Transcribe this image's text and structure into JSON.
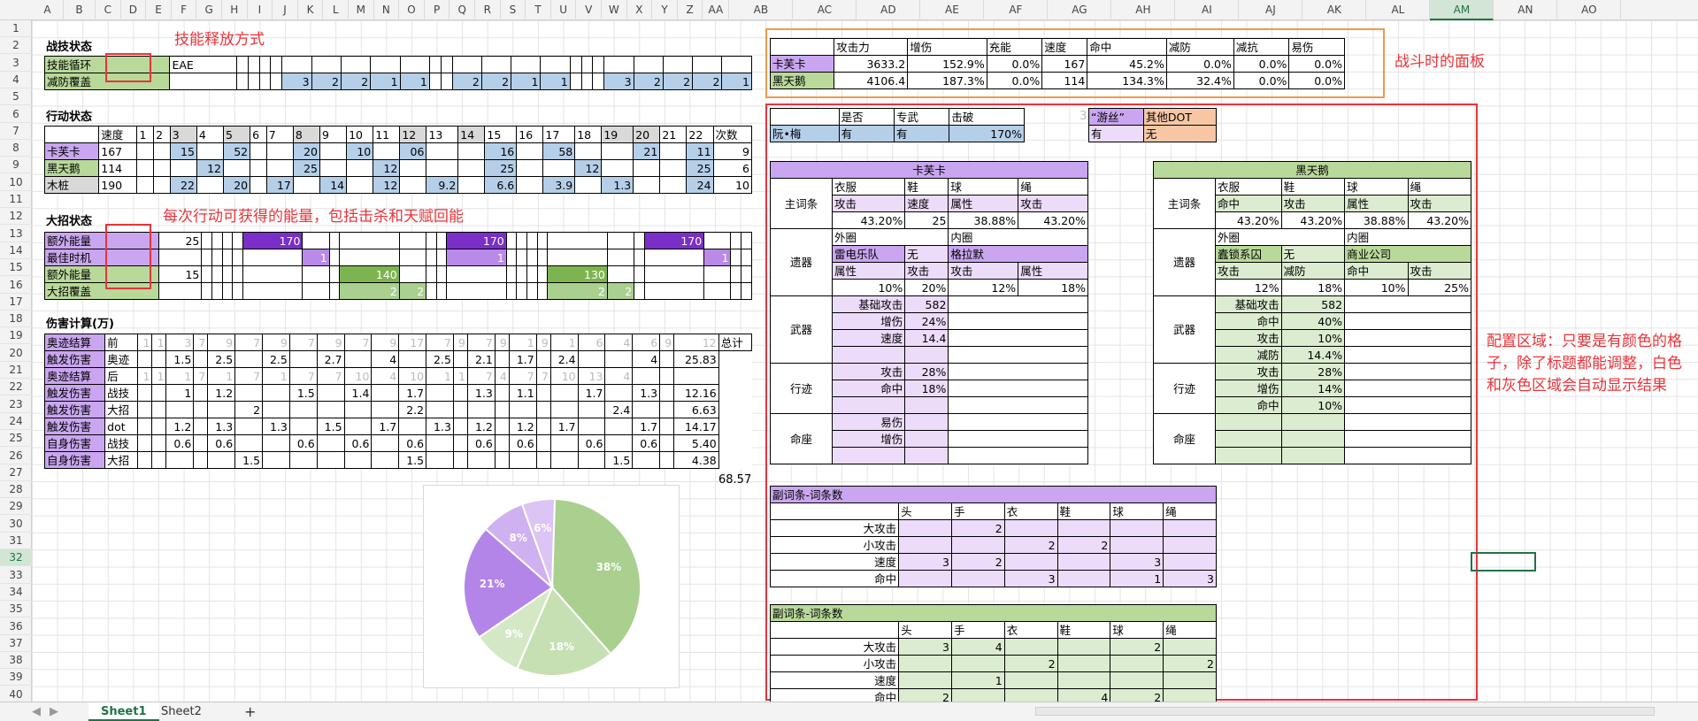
{
  "columns": [
    "A",
    "B",
    "C",
    "D",
    "E",
    "F",
    "G",
    "H",
    "I",
    "J",
    "K",
    "L",
    "M",
    "N",
    "O",
    "P",
    "Q",
    "R",
    "S",
    "T",
    "U",
    "V",
    "W",
    "X",
    "Y",
    "Z",
    "AA",
    "AB",
    "AC",
    "AD",
    "AE",
    "AF",
    "AG",
    "AH",
    "AI",
    "AJ",
    "AK",
    "AL",
    "AM",
    "AN",
    "AO"
  ],
  "rows": [
    "1",
    "2",
    "3",
    "4",
    "5",
    "6",
    "7",
    "8",
    "9",
    "10",
    "11",
    "12",
    "13",
    "14",
    "15",
    "16",
    "17",
    "18",
    "19",
    "20",
    "21",
    "22",
    "23",
    "24",
    "25",
    "26",
    "27",
    "28",
    "29",
    "30",
    "31",
    "32",
    "33",
    "34",
    "35",
    "36",
    "37",
    "38",
    "39",
    "40"
  ],
  "sheet": {
    "tabs": [
      "Sheet1",
      "Sheet2"
    ],
    "add_sheet": "+",
    "selected_cell": "AM32"
  },
  "annotations": {
    "skill_mode": "技能释放方式",
    "energy_note": "每次行动可获得的能量，包括击杀和天赋回能",
    "battle_panel": "战斗时的面板",
    "config_area": "配置区域：只要是有颜色的格子，除了标题都能调整，白色和灰色区域会自动显示结果"
  },
  "battle_skill": {
    "title": "战技状态",
    "rows": [
      {
        "label": "技能循环",
        "value": "EAE"
      },
      {
        "label": "减防覆盖",
        "cells": [
          "",
          "",
          "",
          "",
          "3",
          "2",
          "2",
          "1",
          "1",
          "",
          "",
          "2",
          "2",
          "1",
          "1",
          "",
          "",
          "",
          "3",
          "2",
          "2",
          "2",
          "1"
        ]
      }
    ]
  },
  "action": {
    "title": "行动状态",
    "header": [
      "速度",
      "1",
      "2",
      "3",
      "4",
      "5",
      "6",
      "7",
      "8",
      "9",
      "10",
      "11",
      "12",
      "13",
      "14",
      "15",
      "16",
      "17",
      "18",
      "19",
      "20",
      "21",
      "22",
      "次数"
    ],
    "rows": [
      {
        "label": "卡芙卡",
        "speed": "167",
        "cells": [
          "",
          "",
          "15",
          "",
          "52",
          "",
          "",
          "20",
          "",
          "10",
          "",
          "06",
          "",
          "",
          "16",
          "",
          "58",
          "",
          "",
          "21",
          "",
          "11"
        ],
        "count": "9"
      },
      {
        "label": "黑天鹅",
        "speed": "114",
        "cells": [
          "",
          "",
          "",
          "12",
          "",
          "",
          "",
          "25",
          "",
          "",
          "12",
          "",
          "",
          "",
          "25",
          "",
          "",
          "12",
          "",
          "",
          "",
          "25"
        ],
        "count": "6"
      },
      {
        "label": "木桩",
        "speed": "190",
        "cells": [
          "",
          "",
          "22",
          "",
          "20",
          "",
          "17",
          "",
          "14",
          "",
          "12",
          "",
          "9.2",
          "",
          "6.6",
          "",
          "3.9",
          "",
          "1.3",
          "",
          "",
          "24"
        ],
        "count": "10"
      }
    ]
  },
  "ultimate": {
    "title": "大招状态",
    "rows": [
      {
        "label": "额外能量",
        "value": "25",
        "cells": [
          "",
          "",
          "",
          "",
          "170",
          "",
          "",
          "",
          "",
          "",
          "",
          "170",
          "",
          "",
          "",
          "",
          "",
          "",
          "",
          "170",
          "",
          ""
        ]
      },
      {
        "label": "最佳时机",
        "value": "",
        "cells": [
          "",
          "",
          "",
          "",
          "",
          "1",
          "",
          "",
          "",
          "",
          "",
          "1",
          "",
          "",
          "",
          "",
          "",
          "",
          "",
          "",
          "1",
          ""
        ]
      },
      {
        "label": "额外能量",
        "value": "15",
        "cells": [
          "",
          "",
          "",
          "",
          "",
          "",
          "",
          "140",
          "",
          "",
          "",
          "",
          "",
          "",
          "",
          "",
          "130",
          "",
          "",
          "",
          "",
          ""
        ]
      },
      {
        "label": "大招覆盖",
        "value": "",
        "cells": [
          "",
          "",
          "",
          "",
          "",
          "",
          "",
          "2",
          "2",
          "",
          "",
          "",
          "",
          "",
          "",
          "",
          "2",
          "2",
          "",
          "",
          "",
          ""
        ]
      }
    ]
  },
  "damage": {
    "title": "伤害计算(万)",
    "total_label": "总计",
    "rows": [
      {
        "a": "奥迹结算",
        "b": "前",
        "cells": [
          "1",
          "1",
          "3",
          "7",
          "9",
          "7",
          "9",
          "7",
          "9",
          "7",
          "9",
          "17",
          "7",
          "9",
          "7",
          "9",
          "1",
          "9",
          "1",
          "6",
          "4",
          "6",
          "9",
          "12"
        ],
        "total": ""
      },
      {
        "a": "触发伤害",
        "b": "奥迹",
        "cells": [
          "",
          "",
          "1.5",
          "",
          "2.5",
          "",
          "2.5",
          "",
          "2.7",
          "",
          "4",
          "",
          "2.5",
          "",
          "2.1",
          "",
          "1.7",
          "",
          "2.4",
          "",
          "",
          "4"
        ],
        "total": "25.83"
      },
      {
        "a": "奥迹结算",
        "b": "后",
        "cells": [
          "1",
          "1",
          "1",
          "7",
          "1",
          "7",
          "1",
          "7",
          "7",
          "10",
          "4",
          "10",
          "1",
          "1",
          "7",
          "4",
          "7",
          "7",
          "10",
          "13",
          "4"
        ],
        "total": ""
      },
      {
        "a": "触发伤害",
        "b": "战技",
        "cells": [
          "",
          "",
          "1",
          "",
          "1.2",
          "",
          "",
          "1.5",
          "",
          "1.4",
          "",
          "1.7",
          "",
          "",
          "1.3",
          "",
          "1.1",
          "",
          "",
          "1.7",
          "",
          "1.3"
        ],
        "total": "12.16"
      },
      {
        "a": "触发伤害",
        "b": "大招",
        "cells": [
          "",
          "",
          "",
          "",
          "",
          "2",
          "",
          "",
          "",
          "",
          "",
          "2.2",
          "",
          "",
          "",
          "",
          "",
          "",
          "",
          "",
          "2.4",
          ""
        ],
        "total": "6.63"
      },
      {
        "a": "触发伤害",
        "b": "dot",
        "cells": [
          "",
          "",
          "1.2",
          "",
          "1.3",
          "",
          "1.3",
          "",
          "1.5",
          "",
          "1.7",
          "",
          "1.3",
          "",
          "1.2",
          "",
          "1.2",
          "",
          "1.7",
          "",
          "",
          "1.7"
        ],
        "total": "14.17"
      },
      {
        "a": "自身伤害",
        "b": "战技",
        "cells": [
          "",
          "",
          "0.6",
          "",
          "0.6",
          "",
          "",
          "0.6",
          "",
          "0.6",
          "",
          "0.6",
          "",
          "",
          "0.6",
          "",
          "0.6",
          "",
          "",
          "0.6",
          "",
          "0.6"
        ],
        "total": "5.40"
      },
      {
        "a": "自身伤害",
        "b": "大招",
        "cells": [
          "",
          "",
          "",
          "",
          "",
          "1.5",
          "",
          "",
          "",
          "",
          "",
          "1.5",
          "",
          "",
          "",
          "",
          "",
          "",
          "",
          "",
          "1.5",
          ""
        ],
        "total": "4.38"
      }
    ],
    "grand_total": "68.57"
  },
  "panel": {
    "headers": [
      "攻击力",
      "增伤",
      "充能",
      "速度",
      "命中",
      "减防",
      "减抗",
      "易伤"
    ],
    "rows": [
      {
        "name": "卡芙卡",
        "values": [
          "3633.2",
          "152.9%",
          "0.0%",
          "167",
          "45.2%",
          "0.0%",
          "0.0%",
          "0.0%"
        ]
      },
      {
        "name": "黑天鹅",
        "values": [
          "4106.4",
          "187.3%",
          "0.0%",
          "114",
          "134.3%",
          "32.4%",
          "0.0%",
          "0.0%"
        ]
      }
    ]
  },
  "ruanmei": {
    "headers": [
      "是否",
      "专武",
      "击破"
    ],
    "name": "阮•梅",
    "values": [
      "有",
      "有",
      "170%"
    ]
  },
  "extra": {
    "headers": [
      "“游丝”",
      "其他DOT"
    ],
    "values": [
      "有",
      "无"
    ],
    "prefix": "3"
  },
  "kafka": {
    "title": "卡芙卡",
    "main_label": "主词条",
    "main_slots": [
      "衣服",
      "鞋",
      "球",
      "绳"
    ],
    "main_stats": [
      "攻击",
      "速度",
      "属性",
      "攻击"
    ],
    "main_values": [
      "43.20%",
      "25",
      "38.88%",
      "43.20%"
    ],
    "relic_label": "遗器",
    "outer_label": "外圈",
    "inner_label": "内圈",
    "outer_set": "雷电乐队",
    "outer_set2": "无",
    "inner_set": "格拉默",
    "relic_stats": [
      "属性",
      "攻击",
      "攻击",
      "属性"
    ],
    "relic_values": [
      "10%",
      "20%",
      "12%",
      "18%"
    ],
    "weapon_label": "武器",
    "weapon": [
      [
        "基础攻击",
        "582"
      ],
      [
        "增伤",
        "24%"
      ],
      [
        "速度",
        "14.4"
      ],
      [
        "",
        ""
      ]
    ],
    "trace_label": "行迹",
    "trace": [
      [
        "攻击",
        "28%"
      ],
      [
        "命中",
        "18%"
      ],
      [
        "",
        ""
      ]
    ],
    "eidolon_label": "命座",
    "eidolon": [
      [
        "易伤",
        ""
      ],
      [
        "增伤",
        ""
      ],
      [
        "",
        ""
      ]
    ]
  },
  "swan": {
    "title": "黑天鹅",
    "main_label": "主词条",
    "main_slots": [
      "衣服",
      "鞋",
      "球",
      "绳"
    ],
    "main_stats": [
      "命中",
      "攻击",
      "属性",
      "攻击"
    ],
    "main_values": [
      "43.20%",
      "43.20%",
      "38.88%",
      "43.20%"
    ],
    "relic_label": "遗器",
    "outer_label": "外圈",
    "inner_label": "内圈",
    "outer_set": "蠹锁系囚",
    "outer_set2": "无",
    "inner_set": "商业公司",
    "relic_stats": [
      "攻击",
      "减防",
      "命中",
      "攻击"
    ],
    "relic_values": [
      "12%",
      "18%",
      "10%",
      "25%"
    ],
    "weapon_label": "武器",
    "weapon": [
      [
        "基础攻击",
        "582"
      ],
      [
        "命中",
        "40%"
      ],
      [
        "攻击",
        "10%"
      ],
      [
        "减防",
        "14.4%"
      ]
    ],
    "trace_label": "行迹",
    "trace": [
      [
        "攻击",
        "28%"
      ],
      [
        "增伤",
        "14%"
      ],
      [
        "命中",
        "10%"
      ]
    ],
    "eidolon_label": "命座",
    "eidolon": [
      [
        "",
        ""
      ],
      [
        "",
        ""
      ],
      [
        "",
        ""
      ]
    ]
  },
  "substat_kafka": {
    "title": "副词条-词条数",
    "cols": [
      "头",
      "手",
      "衣",
      "鞋",
      "球",
      "绳"
    ],
    "rows": [
      {
        "label": "大攻击",
        "values": [
          "",
          "2",
          "",
          "",
          "",
          ""
        ]
      },
      {
        "label": "小攻击",
        "values": [
          "",
          "",
          "2",
          "2",
          "",
          ""
        ]
      },
      {
        "label": "速度",
        "values": [
          "3",
          "2",
          "",
          "",
          "3",
          ""
        ]
      },
      {
        "label": "命中",
        "values": [
          "",
          "",
          "3",
          "",
          "1",
          "3"
        ]
      }
    ]
  },
  "substat_swan": {
    "title": "副词条-词条数",
    "cols": [
      "头",
      "手",
      "衣",
      "鞋",
      "球",
      "绳"
    ],
    "rows": [
      {
        "label": "大攻击",
        "values": [
          "3",
          "4",
          "",
          "",
          "2",
          ""
        ]
      },
      {
        "label": "小攻击",
        "values": [
          "",
          "",
          "2",
          "",
          "",
          "2"
        ]
      },
      {
        "label": "速度",
        "values": [
          "",
          "1",
          "",
          "",
          "",
          ""
        ]
      },
      {
        "label": "命中",
        "values": [
          "2",
          "",
          "",
          "4",
          "2",
          ""
        ]
      }
    ]
  },
  "chart_data": {
    "type": "pie",
    "values": [
      38,
      18,
      9,
      21,
      8,
      6
    ],
    "labels": [
      "38%",
      "18%",
      "9%",
      "21%",
      "8%",
      "6%"
    ],
    "colors": [
      "#a9d08e",
      "#c6e0b4",
      "#d5e8c5",
      "#b385e8",
      "#cfb0f0",
      "#dcc4f5"
    ]
  }
}
